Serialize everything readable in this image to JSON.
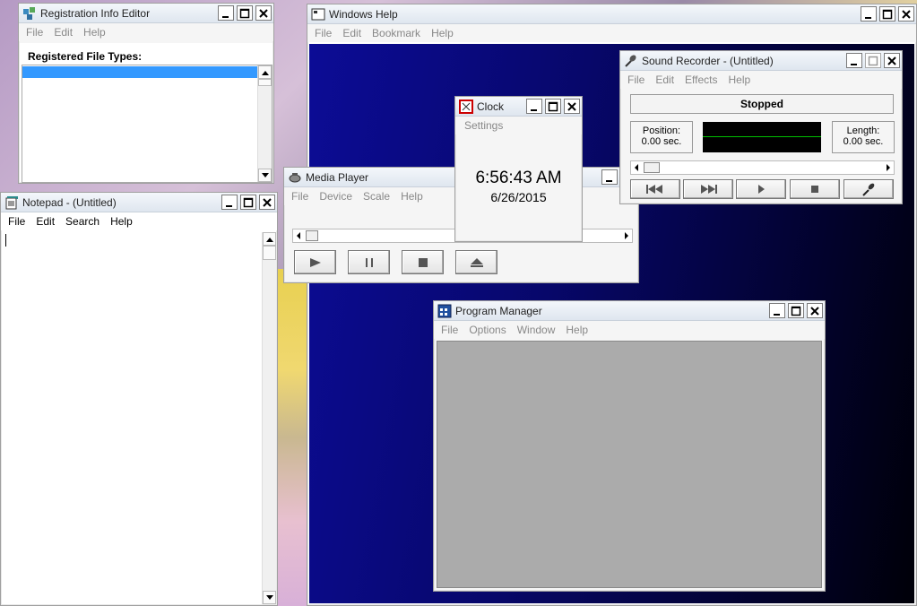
{
  "windows": {
    "reg_editor": {
      "title": "Registration Info Editor",
      "menu": [
        "File",
        "Edit",
        "Help"
      ],
      "label": "Registered File Types:"
    },
    "notepad": {
      "title": "Notepad - (Untitled)",
      "menu": [
        "File",
        "Edit",
        "Search",
        "Help"
      ]
    },
    "windows_help": {
      "title": "Windows Help",
      "menu": [
        "File",
        "Edit",
        "Bookmark",
        "Help"
      ]
    },
    "sound_recorder": {
      "title": "Sound Recorder - (Untitled)",
      "menu": [
        "File",
        "Edit",
        "Effects",
        "Help"
      ],
      "status": "Stopped",
      "position_label": "Position:",
      "position_value": "0.00 sec.",
      "length_label": "Length:",
      "length_value": "0.00 sec."
    },
    "clock": {
      "title": "Clock",
      "menu": [
        "Settings"
      ],
      "time": "6:56:43 AM",
      "date": "6/26/2015"
    },
    "media_player": {
      "title": "Media Player",
      "menu": [
        "File",
        "Device",
        "Scale",
        "Help"
      ]
    },
    "program_manager": {
      "title": "Program Manager",
      "menu": [
        "File",
        "Options",
        "Window",
        "Help"
      ]
    }
  },
  "colors": {
    "help_bg_top": "#0a0a8a",
    "help_bg_bottom": "#000010",
    "selection": "#3399ff",
    "waveform_bg": "#000000",
    "waveform_line": "#00c000",
    "pm_client": "#ababab"
  }
}
